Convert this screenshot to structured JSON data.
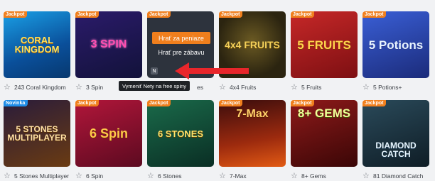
{
  "badges": {
    "jackpot": "Jackpot",
    "novinka": "Novinka"
  },
  "games_row1": [
    {
      "label": "243 Coral Kingdom",
      "badge": "jackpot",
      "art": "CORAL KINGDOM"
    },
    {
      "label": "3 Spin",
      "badge": "jackpot",
      "art": "3 SPIN"
    },
    {
      "label": "es",
      "badge": "jackpot",
      "art": ""
    },
    {
      "label": "4x4 Fruits",
      "badge": "jackpot",
      "art": "4x4 FRUITS"
    },
    {
      "label": "5 Fruits",
      "badge": "jackpot",
      "art": "5 FRUITS"
    },
    {
      "label": "5 Potions+",
      "badge": "jackpot",
      "art": "5 Potions"
    }
  ],
  "games_row2": [
    {
      "label": "5 Stones Multiplayer",
      "badge": "novinka",
      "art": "5 STONES MULTIPLAYER"
    },
    {
      "label": "6 Spin",
      "badge": "jackpot",
      "art": "6 Spin"
    },
    {
      "label": "6 Stones",
      "badge": "jackpot",
      "art": "6 STONES"
    },
    {
      "label": "7-Max",
      "badge": "jackpot",
      "art": "7-Max"
    },
    {
      "label": "8+ Gems",
      "badge": "jackpot",
      "art": "8+ GEMS"
    },
    {
      "label": "81 Diamond Catch",
      "badge": "jackpot",
      "art": "DIAMOND CATCH"
    }
  ],
  "hover": {
    "play_money": "Hrať za peniaze",
    "play_fun": "Hrať pre zábavu",
    "n_icon": "N",
    "tooltip": "Vymeniť Nety na free spiny"
  },
  "colors": {
    "accent": "#f07f1d",
    "novinka": "#1e8de8",
    "arrow": "#e8262b"
  }
}
